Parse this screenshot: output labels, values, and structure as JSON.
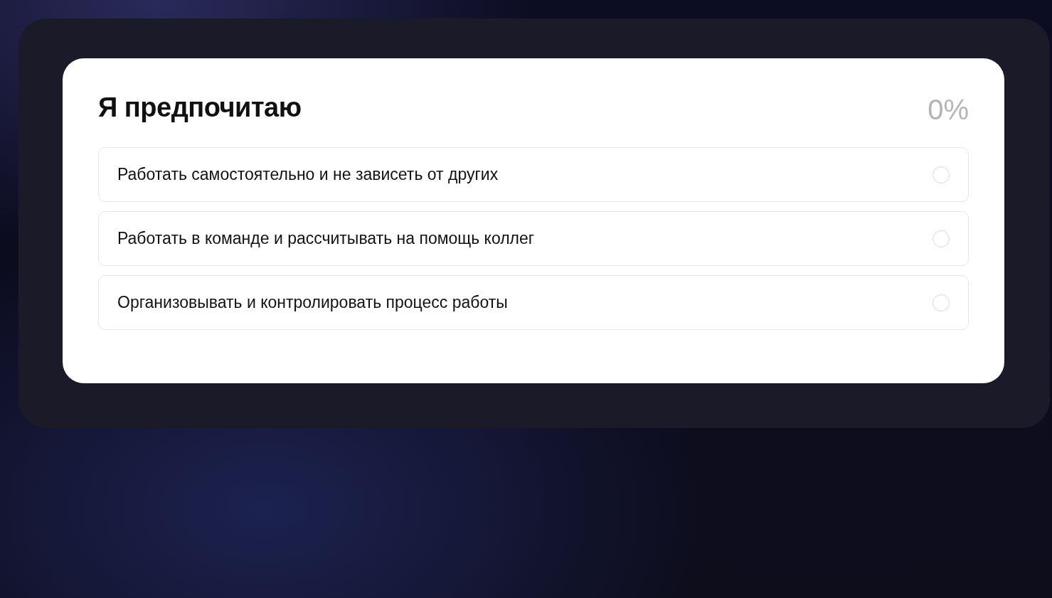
{
  "question": {
    "title": "Я предпочитаю",
    "progress": "0%",
    "options": [
      {
        "label": "Работать самостоятельно и не зависеть от других",
        "selected": false
      },
      {
        "label": "Работать в команде и рассчитывать на помощь коллег",
        "selected": false
      },
      {
        "label": "Организовывать и контролировать процесс работы",
        "selected": false
      }
    ]
  }
}
